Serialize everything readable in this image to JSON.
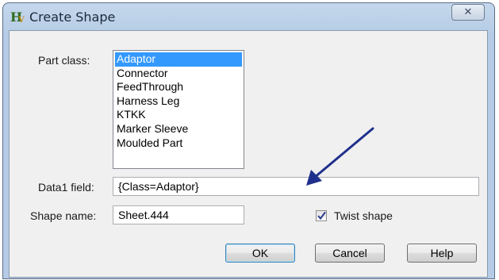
{
  "window": {
    "title": "Create Shape",
    "app_icon": "H",
    "app_icon_sub": "V",
    "close_glyph": "✕"
  },
  "form": {
    "part_class_label": "Part class:",
    "part_class_options": [
      "Adaptor",
      "Connector",
      "FeedThrough",
      "Harness Leg",
      "KTKK",
      "Marker Sleeve",
      "Moulded Part"
    ],
    "part_class_selected": "Adaptor",
    "data1_label": "Data1 field:",
    "data1_value": "{Class=Adaptor}",
    "shape_name_label": "Shape name:",
    "shape_name_value": "Sheet.444",
    "twist_label": "Twist shape",
    "twist_checked": true
  },
  "buttons": {
    "ok": "OK",
    "cancel": "Cancel",
    "help": "Help"
  },
  "annotation": {
    "arrow_color": "#1f2f8c"
  }
}
